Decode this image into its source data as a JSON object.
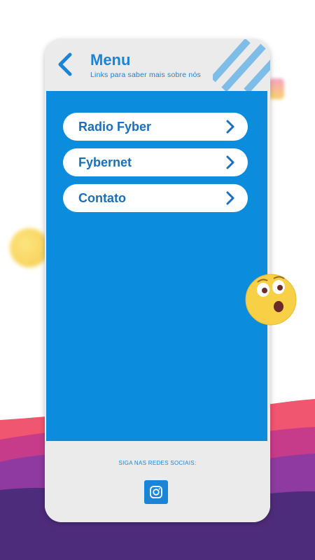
{
  "colors": {
    "primary_blue": "#0b8cdd",
    "accent_blue": "#1a84d6",
    "card_gray": "#ebebeb"
  },
  "header": {
    "back_icon": "chevron-left-icon",
    "title": "Menu",
    "subtitle": "Links para saber mais sobre nós"
  },
  "menu": {
    "items": [
      {
        "label": "Radio Fyber",
        "icon": "chevron-right-icon"
      },
      {
        "label": "Fybernet",
        "icon": "chevron-right-icon"
      },
      {
        "label": "Contato",
        "icon": "chevron-right-icon"
      }
    ]
  },
  "footer": {
    "social_label": "SIGA NAS REDES SOCIAIS:",
    "social_icon": "instagram-icon"
  }
}
